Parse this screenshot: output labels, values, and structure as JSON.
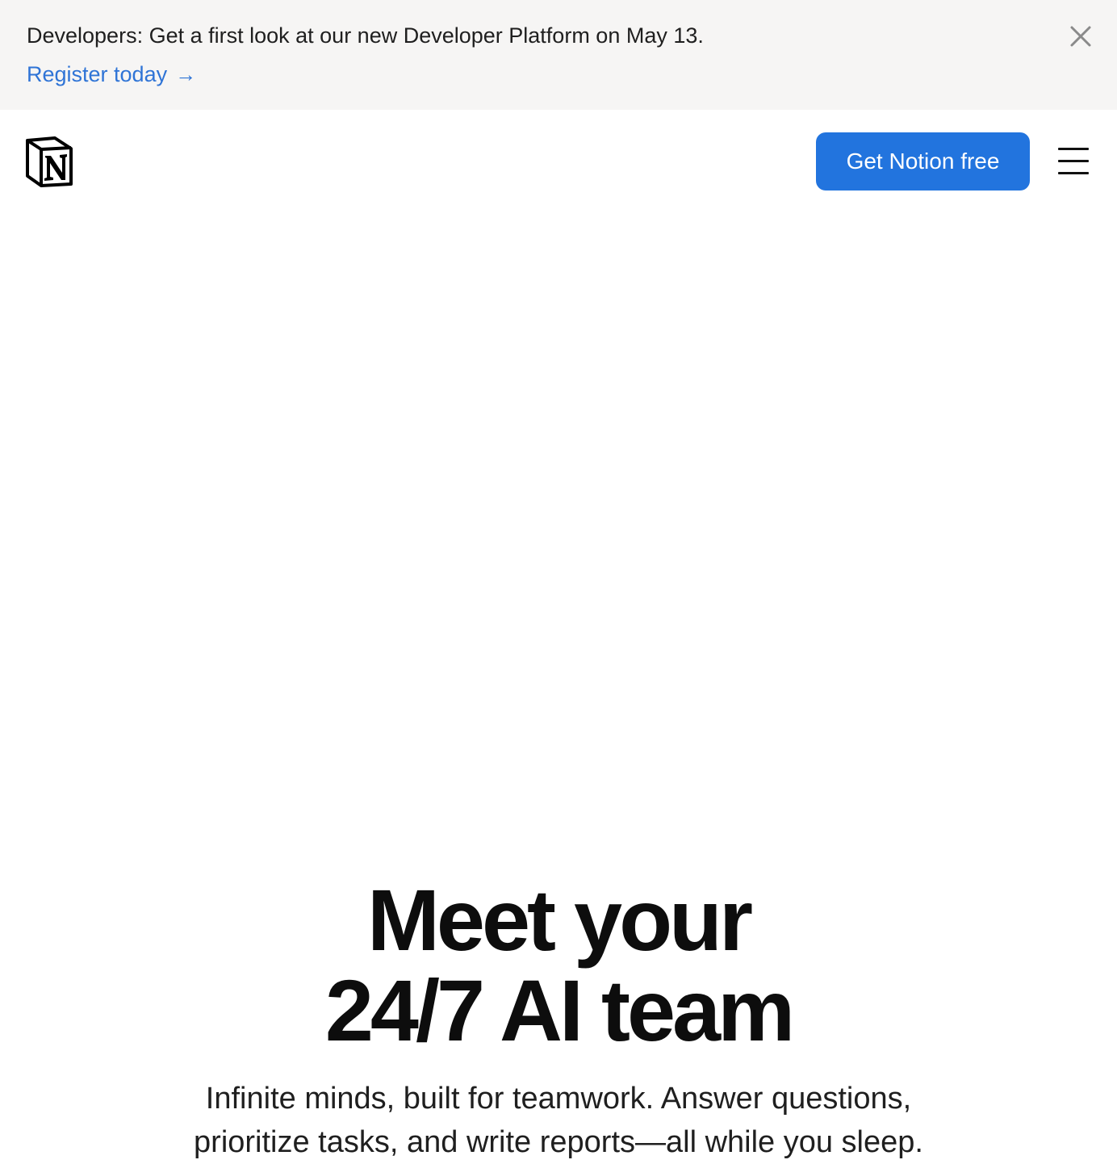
{
  "banner": {
    "message": "Developers: Get a first look at our new Developer Platform on May 13.",
    "link_label": "Register today",
    "link_arrow": "→",
    "close_icon": "close-icon"
  },
  "header": {
    "logo_icon": "notion-logo-icon",
    "cta_label": "Get Notion free",
    "menu_icon": "hamburger-menu-icon"
  },
  "hero": {
    "title_line1": "Meet your",
    "title_line2": "24/7 AI team",
    "subtitle_line1": "Infinite minds, built for teamwork. Answer questions,",
    "subtitle_line2": "prioritize tasks, and write reports—all while you sleep."
  },
  "colors": {
    "banner_bg": "#f6f5f4",
    "link": "#2f74d6",
    "cta_bg": "#2274de",
    "cta_text": "#ffffff"
  }
}
